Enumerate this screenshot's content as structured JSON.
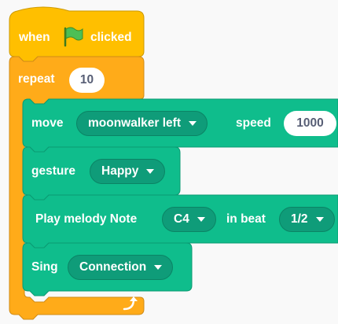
{
  "hat_block": {
    "label_when": "when",
    "flag_icon": "green-flag-icon",
    "label_clicked": "clicked"
  },
  "repeat_block": {
    "label": "repeat",
    "count": "10",
    "loop_icon": "repeat-arrow-icon"
  },
  "move_block": {
    "label": "move",
    "direction": "moonwalker left",
    "speed_label": "speed",
    "speed": "1000"
  },
  "gesture_block": {
    "label": "gesture",
    "value": "Happy"
  },
  "melody_block": {
    "label": "Play melody Note",
    "note": "C4",
    "beat_label": "in beat",
    "beat": "1/2"
  },
  "sing_block": {
    "label": "Sing",
    "value": "Connection"
  },
  "colors": {
    "events": "#ffbf00",
    "control": "#ffab19",
    "extension": "#0fbd8c",
    "extension_dark": "#0f9c79",
    "background": "#f9f9f9"
  }
}
